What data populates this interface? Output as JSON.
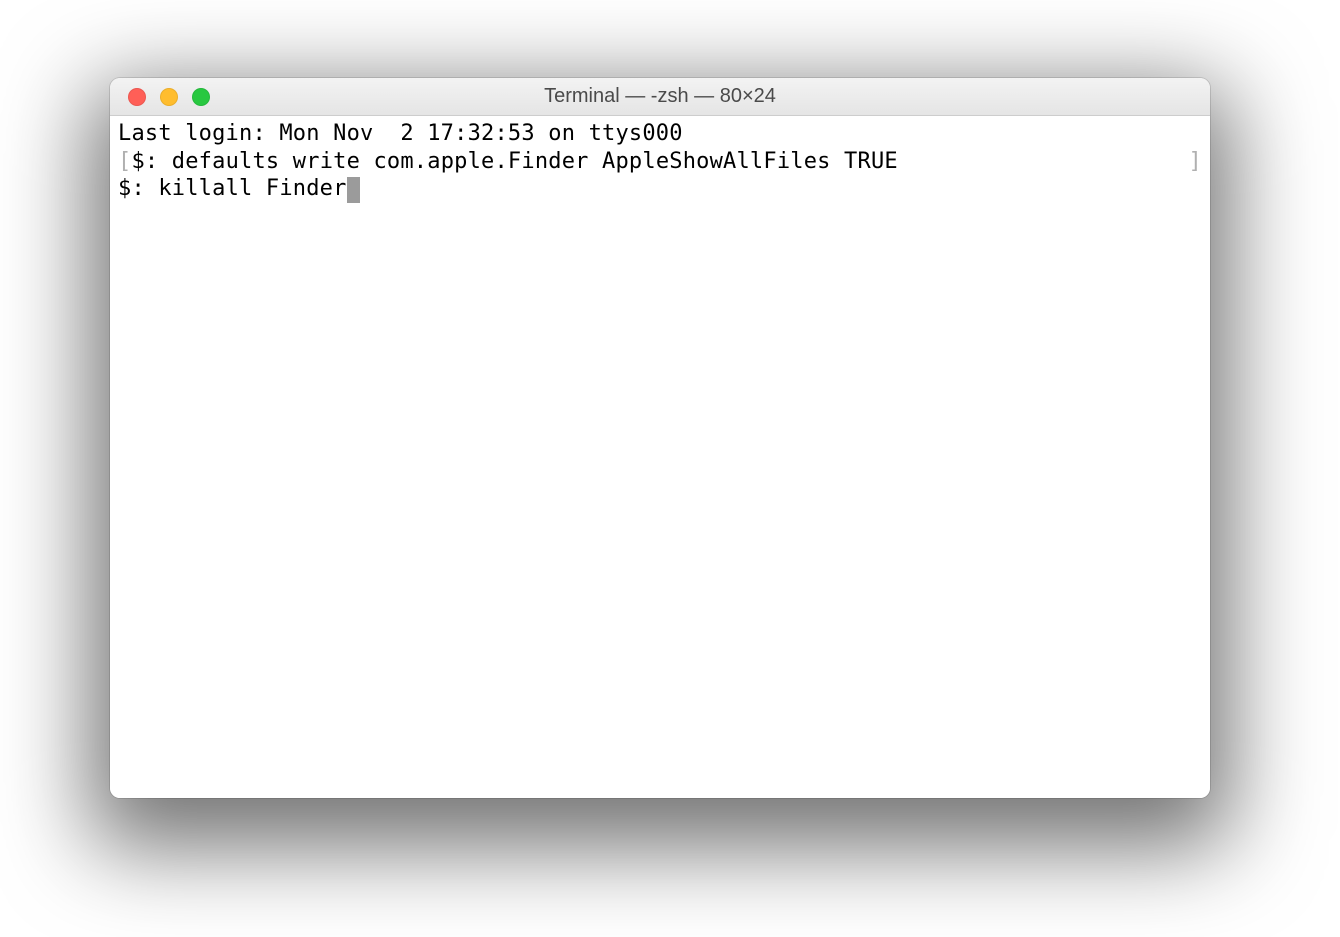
{
  "window": {
    "title": "Terminal — -zsh — 80×24"
  },
  "terminal": {
    "lines": [
      {
        "bracket_left": "",
        "prefix": "",
        "text": "Last login: Mon Nov  2 17:32:53 on ttys000",
        "bracket_right": ""
      },
      {
        "bracket_left": "[",
        "prefix": "$: ",
        "text": "defaults write com.apple.Finder AppleShowAllFiles TRUE",
        "bracket_right": "]"
      },
      {
        "bracket_left": "",
        "prefix": "$: ",
        "text": "killall Finder",
        "bracket_right": "",
        "cursor": true
      }
    ]
  }
}
